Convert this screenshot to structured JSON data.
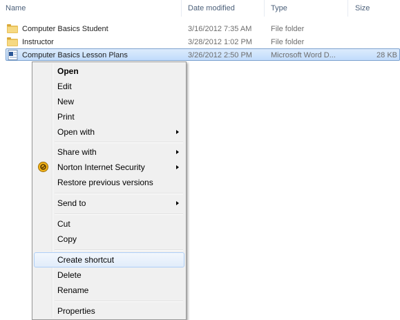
{
  "columns": {
    "name": "Name",
    "date_modified": "Date modified",
    "type": "Type",
    "size": "Size"
  },
  "files": [
    {
      "name": "Computer Basics Student",
      "date": "3/16/2012 7:35 AM",
      "type": "File folder",
      "size": "",
      "icon": "folder-icon"
    },
    {
      "name": "Instructor",
      "date": "3/28/2012 1:02 PM",
      "type": "File folder",
      "size": "",
      "icon": "folder-icon"
    },
    {
      "name": "Computer Basics Lesson Plans",
      "date": "3/26/2012 2:50 PM",
      "type": "Microsoft Word D...",
      "size": "28 KB",
      "icon": "word-document-icon",
      "selected": true
    }
  ],
  "context_menu": {
    "open": "Open",
    "edit": "Edit",
    "new": "New",
    "print": "Print",
    "open_with": "Open with",
    "share_with": "Share with",
    "norton": "Norton Internet Security",
    "restore": "Restore previous versions",
    "send_to": "Send to",
    "cut": "Cut",
    "copy": "Copy",
    "create_shortcut": "Create shortcut",
    "delete": "Delete",
    "rename": "Rename",
    "properties": "Properties",
    "highlighted_item": "Create shortcut"
  },
  "colors": {
    "selection_fill": "#c1dcfc",
    "selection_border": "#7da2ce",
    "menu_background": "#f0f0f0",
    "header_text": "#4c607a",
    "folder_yellow": "#e8c15b"
  }
}
